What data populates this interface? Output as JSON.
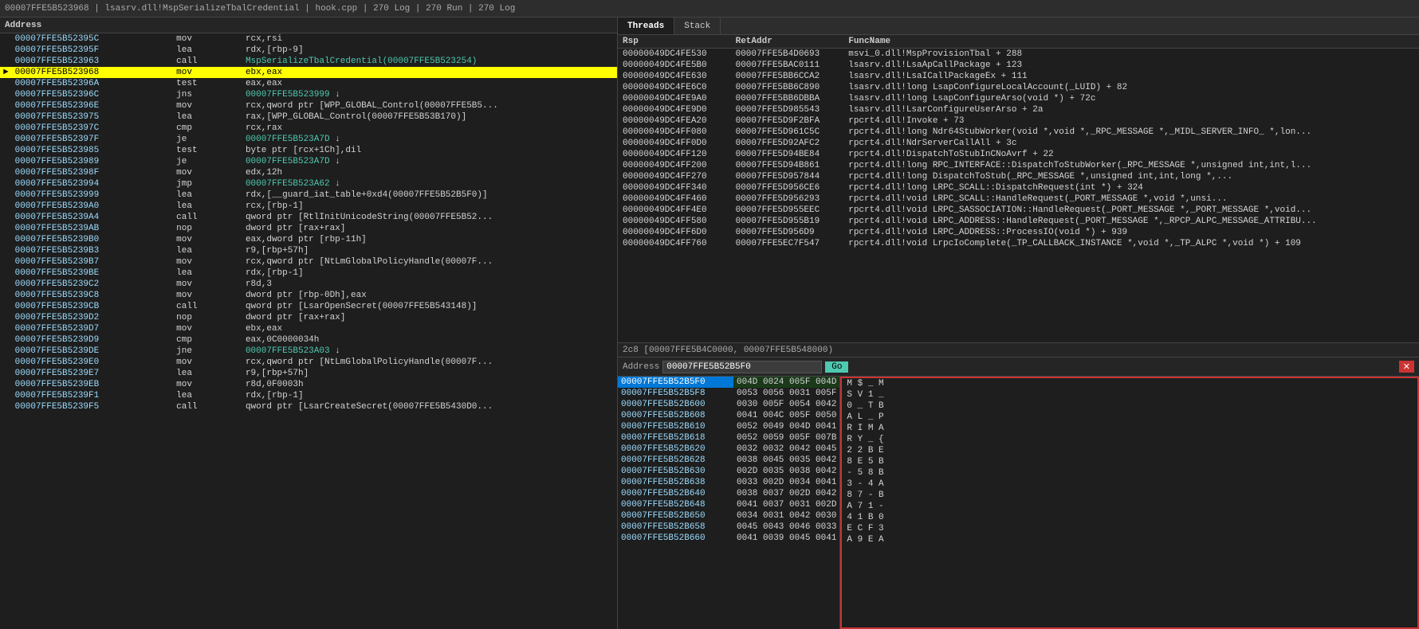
{
  "topbar": {
    "path": "00007FFE5B523968 | lsasrv.dll!MspSerializeTbalCredential | hook.cpp | 270 Log | 270 Run | 270 Log"
  },
  "disasm": {
    "header": "Address",
    "rows": [
      {
        "addr": "00007FFE5B52395C",
        "mnem": "mov",
        "ops": "rcx,rsi",
        "link": "",
        "highlight": false,
        "current": false
      },
      {
        "addr": "00007FFE5B52395F",
        "mnem": "lea",
        "ops": "rdx,[rbp-9]",
        "link": "",
        "highlight": false,
        "current": false
      },
      {
        "addr": "00007FFE5B523963",
        "mnem": "call",
        "ops_link": "MspSerializeTbalCredential(00007FFE5B523254)",
        "highlight": false,
        "current": false
      },
      {
        "addr": "00007FFE5B523968",
        "mnem": "mov",
        "ops": "ebx,eax",
        "link": "",
        "highlight": true,
        "current": false
      },
      {
        "addr": "00007FFE5B52396A",
        "mnem": "test",
        "ops": "eax,eax",
        "link": "",
        "highlight": false,
        "current": false
      },
      {
        "addr": "00007FFE5B52396C",
        "mnem": "jns",
        "ops_link": "00007FFE5B523999",
        "arrow": "↓",
        "highlight": false,
        "current": false
      },
      {
        "addr": "00007FFE5B52396E",
        "mnem": "mov",
        "ops": "rcx,qword ptr [WPP_GLOBAL_Control(00007FFE5B5...",
        "link": "",
        "highlight": false,
        "current": false
      },
      {
        "addr": "00007FFE5B523975",
        "mnem": "lea",
        "ops": "rax,[WPP_GLOBAL_Control(00007FFE5B53B170)]",
        "link": "",
        "highlight": false,
        "current": false
      },
      {
        "addr": "00007FFE5B52397C",
        "mnem": "cmp",
        "ops": "rcx,rax",
        "link": "",
        "highlight": false,
        "current": false
      },
      {
        "addr": "00007FFE5B52397F",
        "mnem": "je",
        "ops_link": "00007FFE5B523A7D",
        "arrow": "↓",
        "highlight": false,
        "current": false
      },
      {
        "addr": "00007FFE5B523985",
        "mnem": "test",
        "ops": "byte ptr [rcx+1Ch],dil",
        "link": "",
        "highlight": false,
        "current": false
      },
      {
        "addr": "00007FFE5B523989",
        "mnem": "je",
        "ops_link": "00007FFE5B523A7D",
        "arrow": "↓",
        "highlight": false,
        "current": false
      },
      {
        "addr": "00007FFE5B52398F",
        "mnem": "mov",
        "ops": "edx,12h",
        "link": "",
        "highlight": false,
        "current": false
      },
      {
        "addr": "00007FFE5B523994",
        "mnem": "jmp",
        "ops_link": "00007FFE5B523A62",
        "arrow": "↓",
        "highlight": false,
        "current": false
      },
      {
        "addr": "00007FFE5B523999",
        "mnem": "lea",
        "ops": "rdx,[__guard_iat_table+0xd4(00007FFE5B52B5F0)]",
        "link": "",
        "highlight": false,
        "current": false
      },
      {
        "addr": "00007FFE5B5239A0",
        "mnem": "lea",
        "ops": "rcx,[rbp-1]",
        "link": "",
        "highlight": false,
        "current": false
      },
      {
        "addr": "00007FFE5B5239A4",
        "mnem": "call",
        "ops": "qword ptr [RtlInitUnicodeString(00007FFE5B52...",
        "link": "",
        "highlight": false,
        "current": false
      },
      {
        "addr": "00007FFE5B5239AB",
        "mnem": "nop",
        "ops": "dword ptr [rax+rax]",
        "link": "",
        "highlight": false,
        "current": false
      },
      {
        "addr": "00007FFE5B5239B0",
        "mnem": "mov",
        "ops": "eax,dword ptr [rbp-11h]",
        "link": "",
        "highlight": false,
        "current": false
      },
      {
        "addr": "00007FFE5B5239B3",
        "mnem": "lea",
        "ops": "r9,[rbp+57h]",
        "link": "",
        "highlight": false,
        "current": false
      },
      {
        "addr": "00007FFE5B5239B7",
        "mnem": "mov",
        "ops": "rcx,qword ptr [NtLmGlobalPolicyHandle(00007F...",
        "link": "",
        "highlight": false,
        "current": false
      },
      {
        "addr": "00007FFE5B5239BE",
        "mnem": "lea",
        "ops": "rdx,[rbp-1]",
        "link": "",
        "highlight": false,
        "current": false
      },
      {
        "addr": "00007FFE5B5239C2",
        "mnem": "mov",
        "ops": "r8d,3",
        "link": "",
        "highlight": false,
        "current": false
      },
      {
        "addr": "00007FFE5B5239C8",
        "mnem": "mov",
        "ops": "dword ptr [rbp-0Dh],eax",
        "link": "",
        "highlight": false,
        "current": false
      },
      {
        "addr": "00007FFE5B5239CB",
        "mnem": "call",
        "ops": "qword ptr [LsarOpenSecret(00007FFE5B543148)]",
        "link": "",
        "highlight": false,
        "current": false
      },
      {
        "addr": "00007FFE5B5239D2",
        "mnem": "nop",
        "ops": "dword ptr [rax+rax]",
        "link": "",
        "highlight": false,
        "current": false
      },
      {
        "addr": "00007FFE5B5239D7",
        "mnem": "mov",
        "ops": "ebx,eax",
        "link": "",
        "highlight": false,
        "current": false
      },
      {
        "addr": "00007FFE5B5239D9",
        "mnem": "cmp",
        "ops": "eax,0C0000034h",
        "link": "",
        "highlight": false,
        "current": false
      },
      {
        "addr": "00007FFE5B5239DE",
        "mnem": "jne",
        "ops_link": "00007FFE5B523A03",
        "arrow": "↓",
        "highlight": false,
        "current": false
      },
      {
        "addr": "00007FFE5B5239E0",
        "mnem": "mov",
        "ops": "rcx,qword ptr [NtLmGlobalPolicyHandle(00007F...",
        "link": "",
        "highlight": false,
        "current": false
      },
      {
        "addr": "00007FFE5B5239E7",
        "mnem": "lea",
        "ops": "r9,[rbp+57h]",
        "link": "",
        "highlight": false,
        "current": false
      },
      {
        "addr": "00007FFE5B5239EB",
        "mnem": "mov",
        "ops": "r8d,0F0003h",
        "link": "",
        "highlight": false,
        "current": false
      },
      {
        "addr": "00007FFE5B5239F1",
        "mnem": "lea",
        "ops": "rdx,[rbp-1]",
        "link": "",
        "highlight": false,
        "current": false
      },
      {
        "addr": "00007FFE5B5239F5",
        "mnem": "call",
        "ops": "qword ptr [LsarCreateSecret(00007FFE5B5430D0...",
        "link": "",
        "highlight": false,
        "current": false
      }
    ]
  },
  "threads": {
    "tab_threads": "Threads",
    "tab_stack": "Stack",
    "columns": [
      "Rsp",
      "RetAddr",
      "FuncName"
    ],
    "rows": [
      {
        "rsp": "00000049DC4FE530",
        "retaddr": "00007FFE5B4D0693",
        "funcname": "msvi_0.dll!MspProvisionTbal + 288"
      },
      {
        "rsp": "00000049DC4FE5B0",
        "retaddr": "00007FFE5BAC0111",
        "funcname": "lsasrv.dll!LsaApCallPackage + 123"
      },
      {
        "rsp": "00000049DC4FE630",
        "retaddr": "00007FFE5BB6CCA2",
        "funcname": "lsasrv.dll!LsaICallPackageEx + 111"
      },
      {
        "rsp": "00000049DC4FE6C0",
        "retaddr": "00007FFE5BB6C890",
        "funcname": "lsasrv.dll!long LsapConfigureLocalAccount(_LUID) + 82"
      },
      {
        "rsp": "00000049DC4FE9A0",
        "retaddr": "00007FFE5BB6DBBA",
        "funcname": "lsasrv.dll!long LsapConfigureArso(void *) + 72c"
      },
      {
        "rsp": "00000049DC4FE9D0",
        "retaddr": "00007FFE5D985543",
        "funcname": "lsasrv.dll!LsarConfigureUserArso + 2a"
      },
      {
        "rsp": "00000049DC4FEA20",
        "retaddr": "00007FFE5D9F2BFA",
        "funcname": "rpcrt4.dll!Invoke + 73"
      },
      {
        "rsp": "00000049DC4FF080",
        "retaddr": "00007FFE5D961C5C",
        "funcname": "rpcrt4.dll!long Ndr64StubWorker(void *,void *,_RPC_MESSAGE *,_MIDL_SERVER_INFO_ *,lon..."
      },
      {
        "rsp": "00000049DC4FF0D0",
        "retaddr": "00007FFE5D92AFC2",
        "funcname": "rpcrt4.dll!NdrServerCallAll + 3c"
      },
      {
        "rsp": "00000049DC4FF120",
        "retaddr": "00007FFE5D94BE84",
        "funcname": "rpcrt4.dll!DispatchToStubInCNoAvrf + 22"
      },
      {
        "rsp": "00000049DC4FF200",
        "retaddr": "00007FFE5D94B861",
        "funcname": "rpcrt4.dll!long RPC_INTERFACE::DispatchToStubWorker(_RPC_MESSAGE *,unsigned int,int,l..."
      },
      {
        "rsp": "00000049DC4FF270",
        "retaddr": "00007FFE5D957844",
        "funcname": "rpcrt4.dll!long DispatchToStub(_RPC_MESSAGE *,unsigned int,int,long *,..."
      },
      {
        "rsp": "00000049DC4FF340",
        "retaddr": "00007FFE5D956CE6",
        "funcname": "rpcrt4.dll!long LRPC_SCALL::DispatchRequest(int *) + 324"
      },
      {
        "rsp": "00000049DC4FF460",
        "retaddr": "00007FFE5D956293",
        "funcname": "rpcrt4.dll!void LRPC_SCALL::HandleRequest(_PORT_MESSAGE *,void *,unsi..."
      },
      {
        "rsp": "00000049DC4FF4E0",
        "retaddr": "00007FFE5D955EEC",
        "funcname": "rpcrt4.dll!void LRPC_SASSOCIATION::HandleRequest(_PORT_MESSAGE *,_PORT_MESSAGE *,void..."
      },
      {
        "rsp": "00000049DC4FF580",
        "retaddr": "00007FFE5D955B19",
        "funcname": "rpcrt4.dll!void LRPC_ADDRESS::HandleRequest(_PORT_MESSAGE *,_RPCP_ALPC_MESSAGE_ATTRIBU..."
      },
      {
        "rsp": "00000049DC4FF6D0",
        "retaddr": "00007FFE5D956D9",
        "funcname": "rpcrt4.dll!void LRPC_ADDRESS::ProcessIO(void *) + 939"
      },
      {
        "rsp": "00000049DC4FF760",
        "retaddr": "00007FFE5EC7F547",
        "funcname": "rpcrt4.dll!void LrpcIoComplete(_TP_CALLBACK_INSTANCE *,void *,_TP_ALPC *,void *) + 109"
      }
    ]
  },
  "callstack_label": "2c8 [00007FFE5B4C0000, 00007FFE5B548000)",
  "memory_panel": {
    "label": "Address",
    "addr_value": "00007FFE5B52B5F0",
    "go_label": "Go",
    "close_label": "✕",
    "rows": [
      {
        "addr": "00007FFE5B52B5F0",
        "bytes": "004D 0024 005F 004D",
        "ascii": "M $ _ M",
        "highlight": true
      },
      {
        "addr": "00007FFE5B52B5F8",
        "bytes": "0053 0056 0031 005F",
        "ascii": "S V 1 _",
        "highlight": false
      },
      {
        "addr": "00007FFE5B52B600",
        "bytes": "0030 005F 0054 0042",
        "ascii": "0 _ T B",
        "highlight": false
      },
      {
        "addr": "00007FFE5B52B608",
        "bytes": "0041 004C 005F 0050",
        "ascii": "A L _ P",
        "highlight": false
      },
      {
        "addr": "00007FFE5B52B610",
        "bytes": "0052 0049 004D 0041",
        "ascii": "R I M A",
        "highlight": false
      },
      {
        "addr": "00007FFE5B52B618",
        "bytes": "0052 0059 005F 007B",
        "ascii": "R Y _ {",
        "highlight": false
      },
      {
        "addr": "00007FFE5B52B620",
        "bytes": "0032 0032 0042 0045",
        "ascii": "2 2 B E",
        "highlight": false
      },
      {
        "addr": "00007FFE5B52B628",
        "bytes": "0038 0045 0035 0042",
        "ascii": "8 E 5 B",
        "highlight": false
      },
      {
        "addr": "00007FFE5B52B630",
        "bytes": "002D 0035 0038 0042",
        "ascii": "- 5 8 B",
        "highlight": false
      },
      {
        "addr": "00007FFE5B52B638",
        "bytes": "0033 002D 0034 0041",
        "ascii": "3 - 4 A",
        "highlight": false
      },
      {
        "addr": "00007FFE5B52B640",
        "bytes": "0038 0037 002D 0042",
        "ascii": "8 7 - B",
        "highlight": false
      },
      {
        "addr": "00007FFE5B52B648",
        "bytes": "0041 0037 0031 002D",
        "ascii": "A 7 1 -",
        "highlight": false
      },
      {
        "addr": "00007FFE5B52B650",
        "bytes": "0034 0031 0042 0030",
        "ascii": "4 1 B 0",
        "highlight": false
      },
      {
        "addr": "00007FFE5B52B658",
        "bytes": "0045 0043 0046 0033",
        "ascii": "E C F 3",
        "highlight": false
      },
      {
        "addr": "00007FFE5B52B660",
        "bytes": "0041 0039 0045 0041",
        "ascii": "A 9 E A",
        "highlight": false
      }
    ]
  }
}
